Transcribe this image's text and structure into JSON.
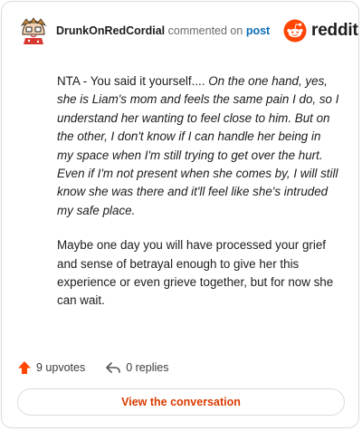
{
  "header": {
    "username": "DrunkOnRedCordial",
    "commented_on": "commented on",
    "post_link": "post",
    "brand_name": "reddit",
    "brand_color": "#ff4500"
  },
  "comment": {
    "paragraph1_prefix": "NTA - You said it yourself.... ",
    "paragraph1_quote": "On the one hand, yes, she is Liam's mom and feels the same pain I do, so I understand her wanting to feel close to him. But on the other, I don't know if I can handle her being in my space when I'm still trying to get over the hurt. Even if I'm not present when she comes by, I will still know she was there and it'll feel like she's intruded my safe place.",
    "paragraph2": "Maybe one day you will have processed your grief and sense of betrayal enough to give her this experience or even grieve together, but for now she can wait."
  },
  "footer": {
    "upvotes": "9 upvotes",
    "replies": "0 replies",
    "view_button": "View the conversation",
    "accent_color": "#d93a00"
  },
  "icons": [
    "avatar",
    "reddit-logo-icon",
    "upvote-arrow-icon",
    "reply-arrow-icon"
  ]
}
